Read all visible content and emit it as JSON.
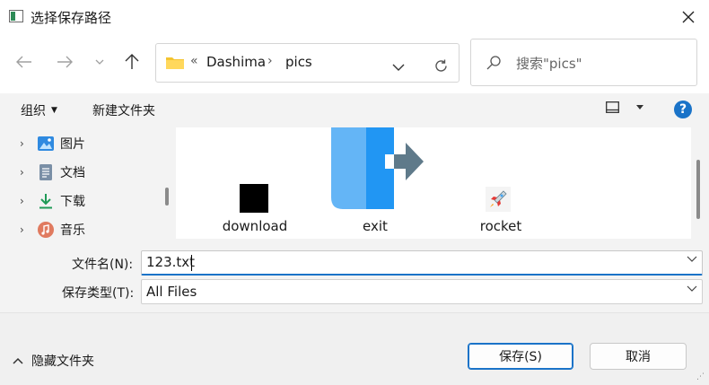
{
  "window": {
    "title": "选择保存路径"
  },
  "address": {
    "crumb_sep0": "«",
    "crumbs": [
      "Dashima",
      "pics"
    ],
    "crumb_sep": "›"
  },
  "search": {
    "placeholder": "搜索\"pics\""
  },
  "toolbar": {
    "organize_label": "组织",
    "new_folder_label": "新建文件夹",
    "help_label": "?"
  },
  "nav_pane": {
    "items": [
      {
        "label": "图片",
        "icon": "pictures-icon"
      },
      {
        "label": "文档",
        "icon": "documents-icon"
      },
      {
        "label": "下载",
        "icon": "downloads-icon"
      },
      {
        "label": "音乐",
        "icon": "music-icon"
      }
    ]
  },
  "files": [
    {
      "name": "download",
      "icon": "black-square-thumbnail"
    },
    {
      "name": "exit",
      "icon": "exit-arrow-thumbnail"
    },
    {
      "name": "rocket",
      "icon": "rocket-icon"
    }
  ],
  "form": {
    "filename_label": "文件名(N):",
    "filename_value": "123.txt",
    "type_label": "保存类型(T):",
    "type_value": "All Files"
  },
  "footer": {
    "hide_folders_label": "隐藏文件夹",
    "save_label": "保存(S)",
    "cancel_label": "取消"
  },
  "colors": {
    "accent": "#1a73c8",
    "folder": "#f4c430"
  }
}
